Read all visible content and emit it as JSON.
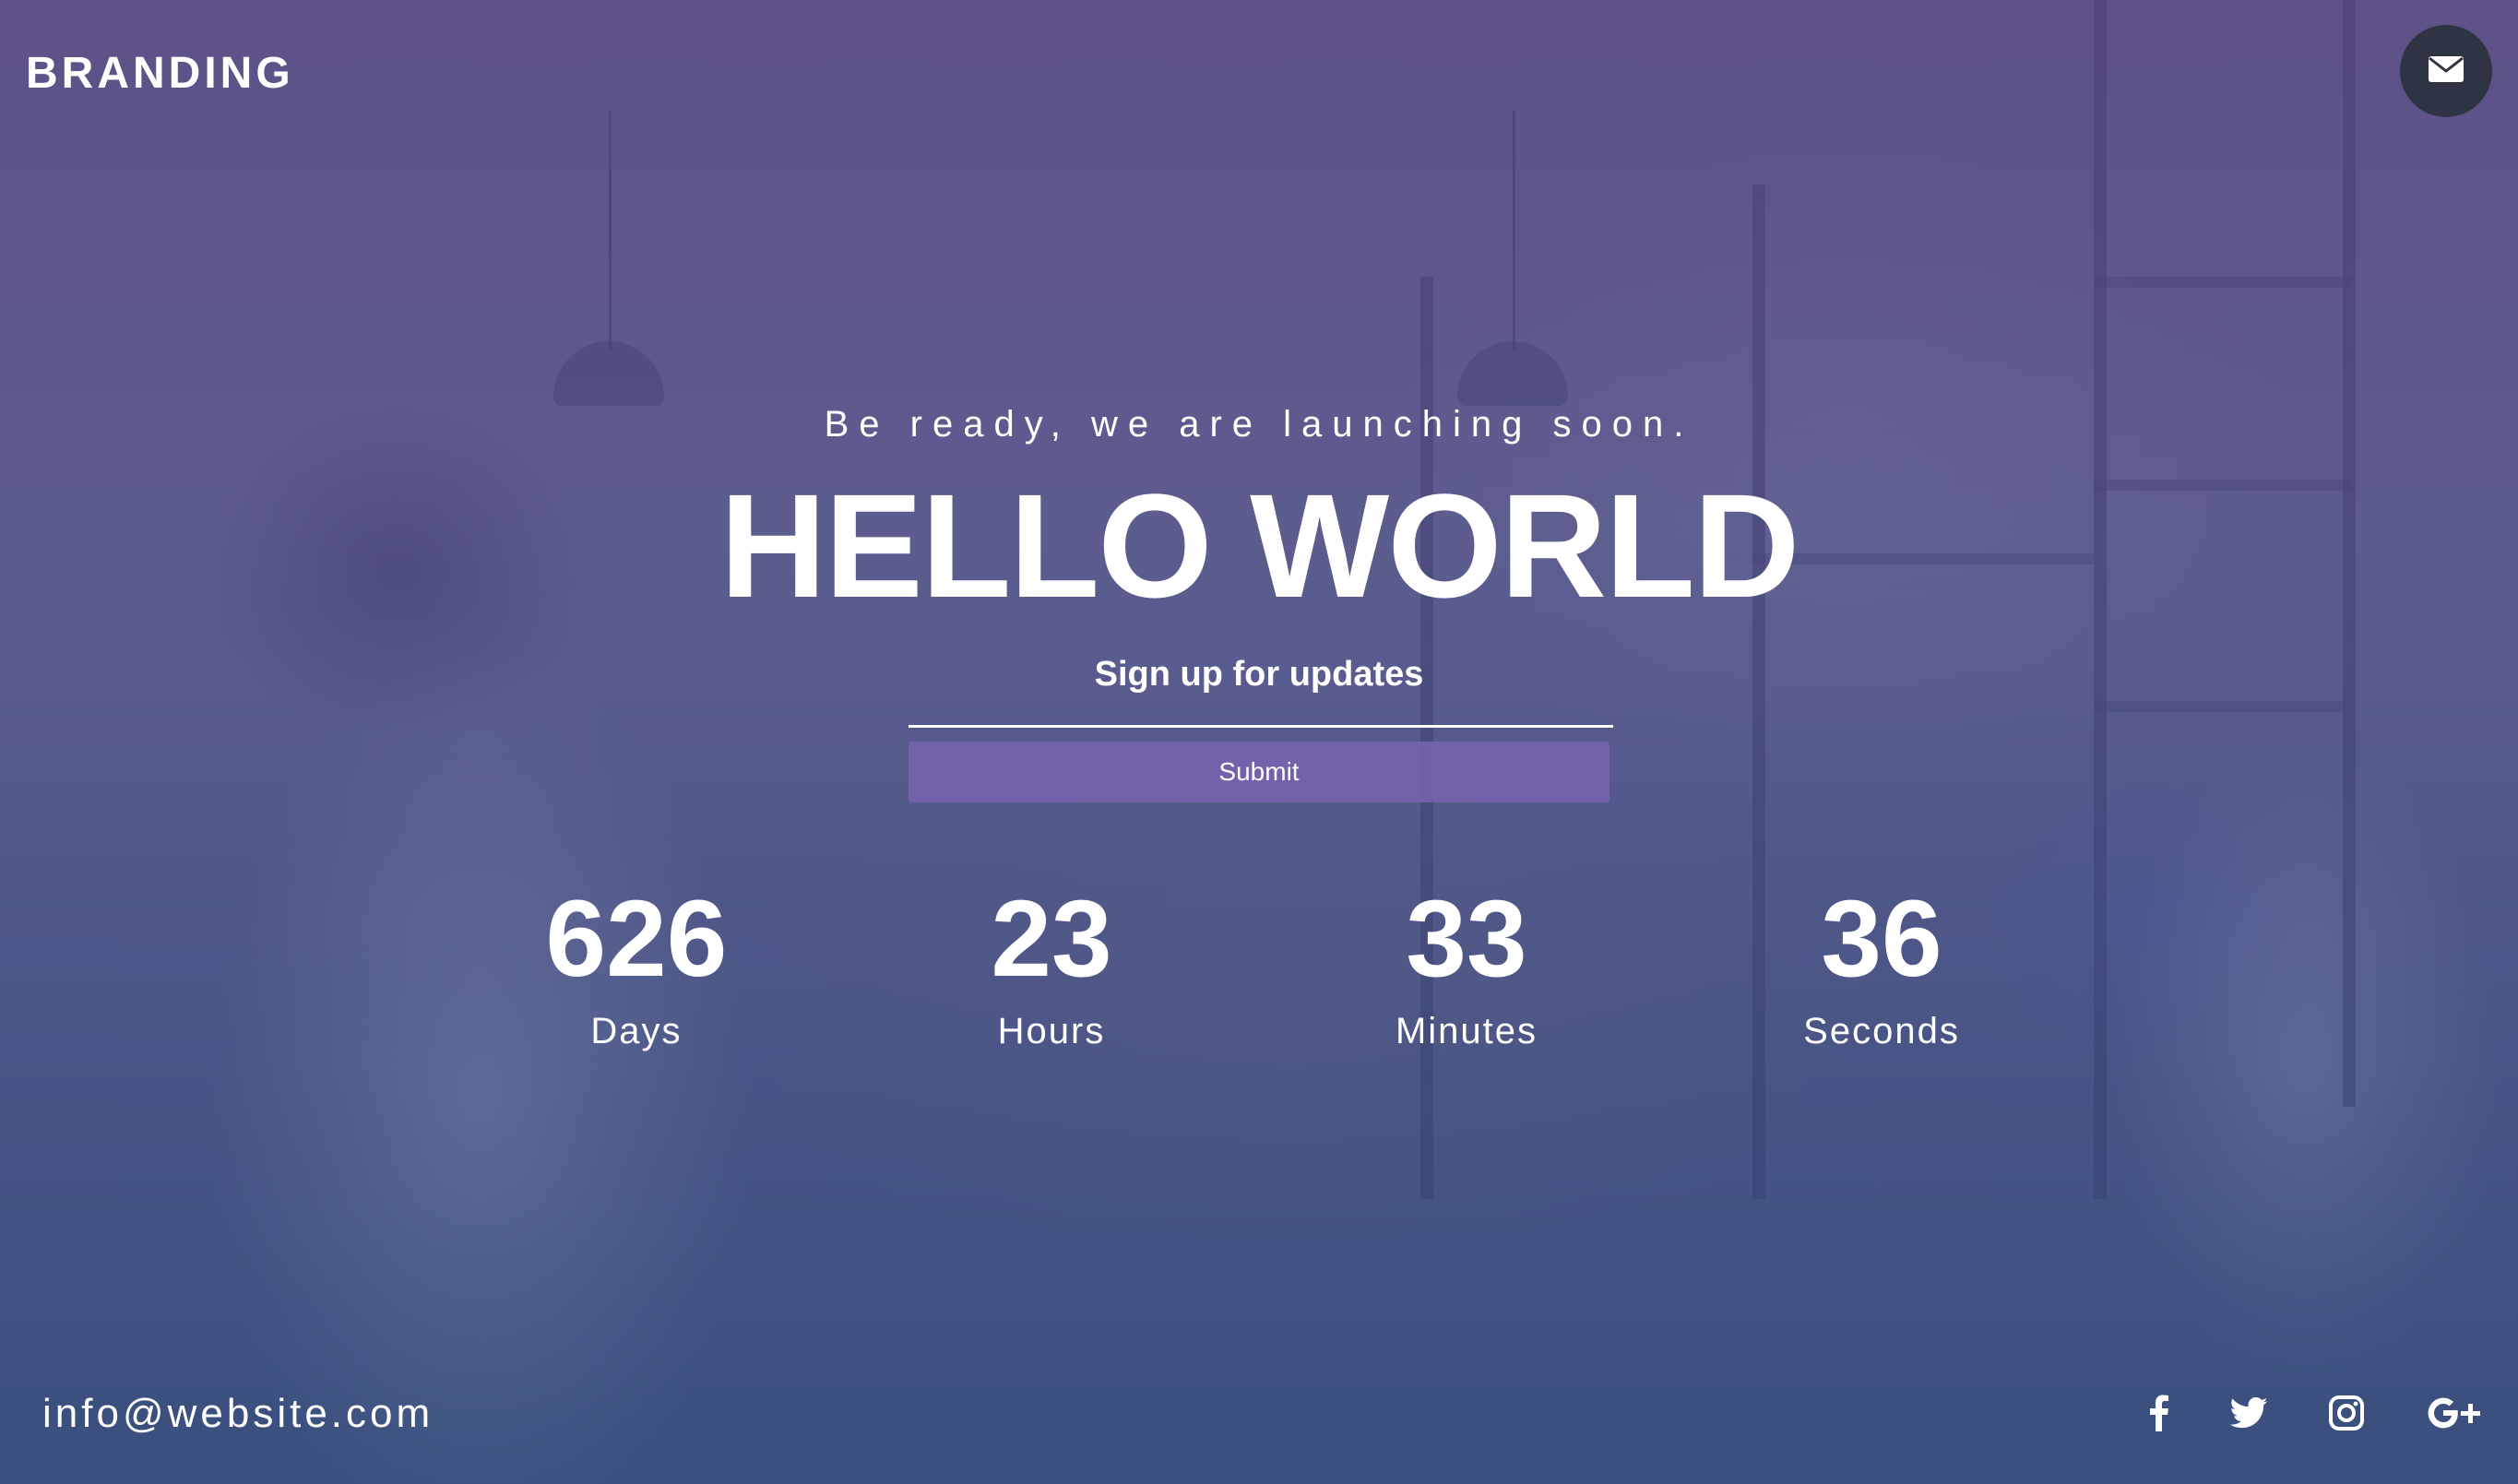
{
  "header": {
    "brand": "BRANDING",
    "mail_icon": "envelope-icon"
  },
  "hero": {
    "tagline": "Be ready, we are launching soon.",
    "title": "HELLO WORLD",
    "signup_label": "Sign up for updates",
    "email_value": "",
    "submit_label": "Submit"
  },
  "countdown": [
    {
      "value": "626",
      "unit": "Days"
    },
    {
      "value": "23",
      "unit": "Hours"
    },
    {
      "value": "33",
      "unit": "Minutes"
    },
    {
      "value": "36",
      "unit": "Seconds"
    }
  ],
  "footer": {
    "email": "info@website.com",
    "social": [
      {
        "icon": "facebook-icon"
      },
      {
        "icon": "twitter-icon"
      },
      {
        "icon": "instagram-icon"
      },
      {
        "icon": "google-plus-icon"
      }
    ]
  },
  "colors": {
    "overlay_top": "#5a4682",
    "overlay_bottom": "#375082",
    "mail_button": "#2f3445",
    "submit_button": "#7864af"
  }
}
